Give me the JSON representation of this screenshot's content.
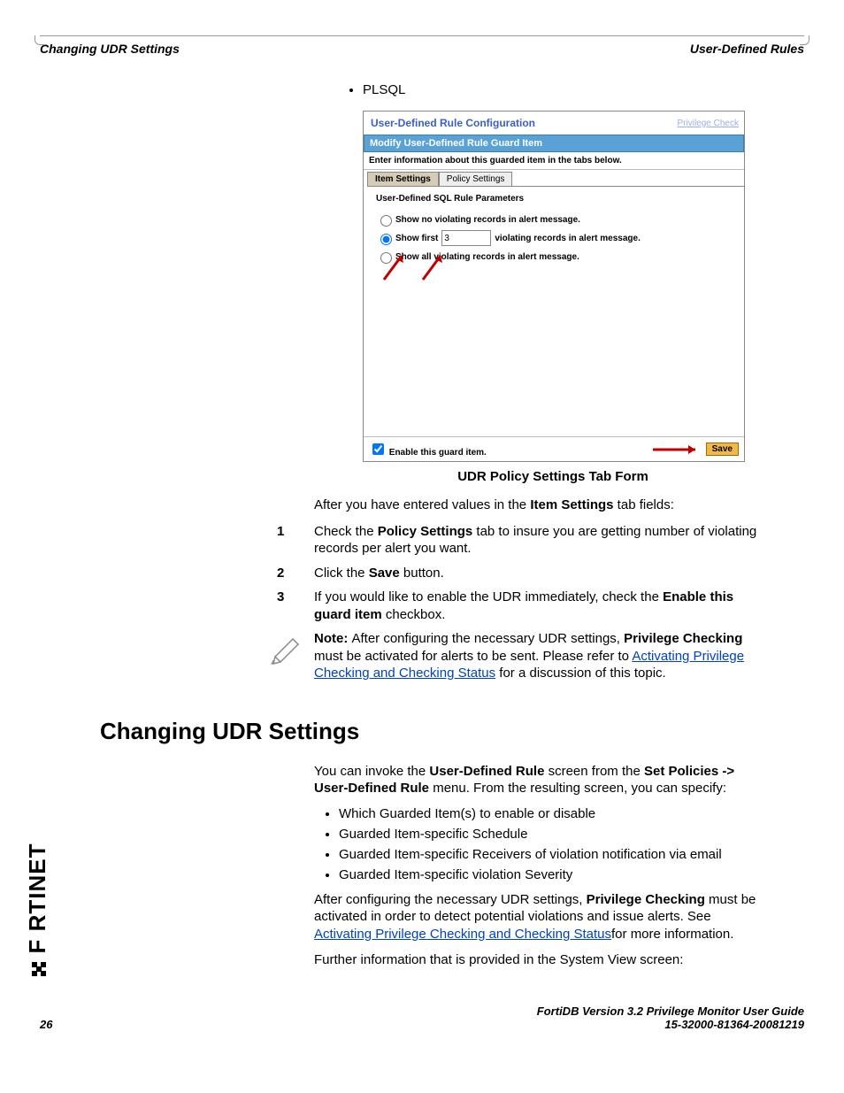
{
  "header": {
    "left": "Changing UDR Settings",
    "right": "User-Defined Rules"
  },
  "top_bullet": "PLSQL",
  "screenshot": {
    "title": "User-Defined Rule Configuration",
    "top_link": "Privilege Check",
    "bar": "Modify User-Defined Rule Guard Item",
    "sub": "Enter information about this guarded item in the tabs below.",
    "tab_active": "Item Settings",
    "tab_inactive": "Policy Settings",
    "body_title": "User-Defined SQL Rule Parameters",
    "radio1": "Show no violating records in alert message.",
    "radio2_a": "Show first",
    "radio2_value": "3",
    "radio2_b": "violating records in alert message.",
    "radio3": "Show all violating records in alert message.",
    "enable_label": "Enable this guard item.",
    "save": "Save"
  },
  "caption": "UDR Policy Settings Tab Form",
  "para_after_caption_a": "After you have entered values in the ",
  "para_after_caption_b": "Item Settings",
  "para_after_caption_c": " tab fields:",
  "steps": [
    {
      "n": "1",
      "a": "Check the ",
      "b": "Policy Settings",
      "c": " tab to insure you are getting number of violating records per alert you want."
    },
    {
      "n": "2",
      "a": "Click the ",
      "b": "Save",
      "c": " button."
    },
    {
      "n": "3",
      "a": "If you would like to enable the UDR immediately, check the ",
      "b": "Enable this guard item",
      "c": " checkbox."
    }
  ],
  "note": {
    "lead": "Note: ",
    "a": "After configuring the necessary UDR settings, ",
    "b": "Privilege Checking",
    "c": " must be activated for alerts to be sent. Please refer to ",
    "link": " Activating Privilege Checking and Checking Status",
    "d": " for a discussion of this topic."
  },
  "section_heading": "Changing UDR Settings",
  "section_p1_a": "You can invoke the ",
  "section_p1_b": "User-Defined Rule",
  "section_p1_c": " screen from the ",
  "section_p1_d": "Set Policies -> User-Defined Rule",
  "section_p1_e": " menu. From the resulting screen, you can specify:",
  "section_bullets": [
    "Which Guarded Item(s) to enable or disable",
    "Guarded Item-specific Schedule",
    "Guarded Item-specific Receivers of violation notification via email",
    "Guarded Item-specific violation Severity"
  ],
  "section_p2_a": "After configuring the necessary UDR settings, ",
  "section_p2_b": "Privilege Checking",
  "section_p2_c": " must be activated in order to detect potential violations and issue alerts. See ",
  "section_p2_link": " Activating Privilege Checking and Checking Status",
  "section_p2_d": "for more information.",
  "section_p3": "Further information that is provided in the System View screen:",
  "footer": {
    "line1": "FortiDB Version 3.2 Privilege Monitor  User Guide",
    "line2": "15-32000-81364-20081219",
    "page": "26"
  }
}
